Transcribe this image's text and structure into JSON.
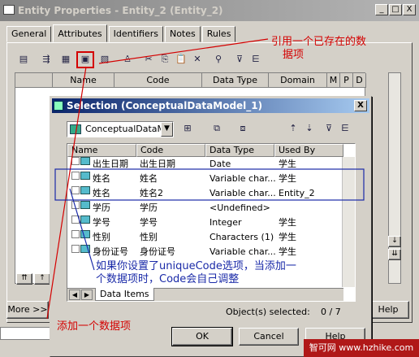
{
  "main_window": {
    "title": "Entity Properties - Entity_2 (Entity_2)",
    "buttons": {
      "minimize": "_",
      "maximize": "□",
      "close": "X"
    },
    "tabs": [
      {
        "label": "General",
        "active": false
      },
      {
        "label": "Attributes",
        "active": true
      },
      {
        "label": "Identifiers",
        "active": false
      },
      {
        "label": "Notes",
        "active": false
      },
      {
        "label": "Rules",
        "active": false
      }
    ],
    "toolbar_icons": [
      "properties-icon",
      "insert-row-icon",
      "add-attributes-icon",
      "reuse-attributes-icon",
      "rule-icon",
      "cut-icon",
      "copy-icon",
      "paste-icon",
      "delete-icon",
      "find-icon",
      "filter-icon",
      "customize-columns-icon"
    ],
    "grid_headers": {
      "name": "Name",
      "code": "Code",
      "data_type": "Data Type",
      "domain": "Domain",
      "m": "M",
      "p": "P",
      "d": "D"
    },
    "more_button": "More >>",
    "help_button": "Help"
  },
  "selection_dialog": {
    "title": "Selection (ConceptualDataModel_1)",
    "close": "X",
    "model_combo": "ConceptualDataMo",
    "columns": {
      "name": "Name",
      "code": "Code",
      "data_type": "Data Type",
      "used_by": "Used By"
    },
    "rows": [
      {
        "name": "出生日期",
        "code": "出生日期",
        "data_type": "Date",
        "used_by": "学生"
      },
      {
        "name": "姓名",
        "code": "姓名",
        "data_type": "Variable char...",
        "used_by": "学生"
      },
      {
        "name": "姓名",
        "code": "姓名2",
        "data_type": "Variable char...",
        "used_by": "Entity_2"
      },
      {
        "name": "学历",
        "code": "学历",
        "data_type": "<Undefined>",
        "used_by": ""
      },
      {
        "name": "学号",
        "code": "学号",
        "data_type": "Integer",
        "used_by": "学生"
      },
      {
        "name": "性别",
        "code": "性别",
        "data_type": "Characters (1)",
        "used_by": "学生"
      },
      {
        "name": "身份证号",
        "code": "身份证号",
        "data_type": "Variable char...",
        "used_by": "学生"
      }
    ],
    "list_tab": "Data Items",
    "objects_selected_label": "Object(s) selected:",
    "objects_selected_value": "0 / 7",
    "ok_button": "OK",
    "cancel_button": "Cancel",
    "help_button": "Help"
  },
  "annotations": {
    "reuse_note_line1": "引用一个已存在的数",
    "reuse_note_line2": "据项",
    "uniquecode_note_line1": "如果你设置了uniqueCode选项，当添加一",
    "uniquecode_note_line2": "个数据项时，Code会自己调整",
    "add_note": "添加一个数据项"
  },
  "watermark": "智可网 www.hzhike.com",
  "colors": {
    "annotation_red": "#d40000",
    "annotation_blue": "#1a2aa8",
    "dialog_title": "#0a246a"
  }
}
